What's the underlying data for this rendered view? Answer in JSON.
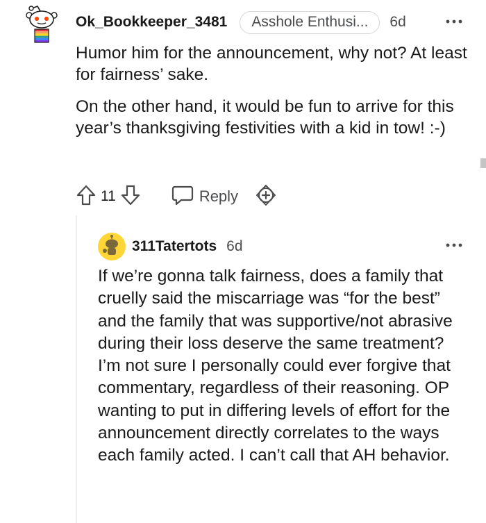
{
  "comment": {
    "author": "Ok_Bookkeeper_3481",
    "flair": "Asshole Enthusi...",
    "time": "6d",
    "paragraphs": [
      "Humor him for the announcement, why not? At least for fairness’ sake.",
      "On the other hand, it would be fun to arrive for this year’s thanksgiving festivities with a kid in tow! :-)"
    ],
    "votes": "11",
    "reply_label": "Reply"
  },
  "reply": {
    "author": "311Tatertots",
    "time": "6d",
    "text": "If we’re gonna talk fairness, does a family that cruelly said the miscarriage was “for the best” and the family that was supportive/not abrasive during their loss deserve the same treatment? I’m not sure I personally could ever forgive that commentary, regardless of their reasoning. OP wanting to put in differing levels of effort for the announcement directly correlates to the ways each family acted. I can’t call that AH behavior."
  },
  "icons": {
    "avatar": "snoo-avatar-icon",
    "avatar_reply": "snoo-avatar-icon",
    "more": "more-options-icon",
    "upvote": "upvote-arrow-icon",
    "downvote": "downvote-arrow-icon",
    "reply": "speech-bubble-icon",
    "award": "award-plus-icon"
  },
  "colors": {
    "text": "#1a1a1b",
    "meta": "#4a4b4d",
    "thread_line": "#edeff1",
    "avatar_reply_bg": "#ffd635"
  }
}
